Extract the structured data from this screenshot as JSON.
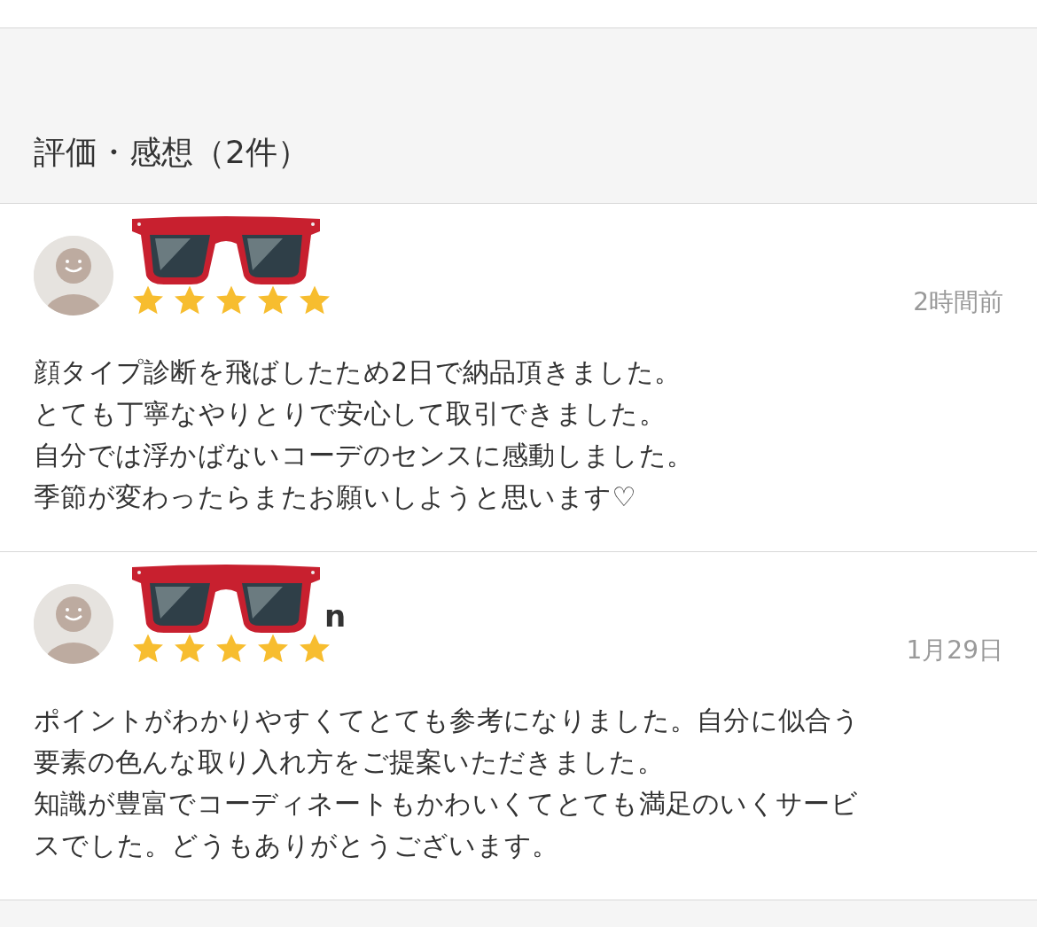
{
  "section_title": "評価・感想（2件）",
  "reviews": [
    {
      "stars": 5,
      "time": "2時間前",
      "lines": [
        "顔タイプ診断を飛ばしたため2日で納品頂きました。",
        "とても丁寧なやりとりで安心して取引できました。",
        "自分では浮かばないコーデのセンスに感動しました。",
        "季節が変わったらまたお願いしようと思います♡"
      ]
    },
    {
      "name_visible": "n",
      "stars": 5,
      "time": "1月29日",
      "lines": [
        "ポイントがわかりやすくてとても参考になりました。自分に似合う",
        "要素の色んな取り入れ方をご提案いただきました。",
        "知識が豊富でコーディネートもかわいくてとても満足のいくサービ",
        "スでした。どうもありがとうございます。"
      ]
    }
  ]
}
